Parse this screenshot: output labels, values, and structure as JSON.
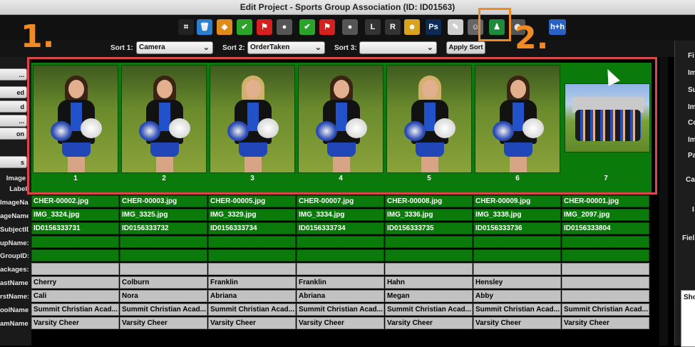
{
  "window": {
    "title": "Edit Project - Sports Group Association (ID: ID01563)"
  },
  "toolbar": {
    "icons": [
      {
        "name": "crop-icon",
        "glyph": "⌗",
        "color": "#222"
      },
      {
        "name": "trash-icon",
        "glyph": "🗑",
        "color": "#2b7fd1"
      },
      {
        "name": "tag-icon",
        "glyph": "◆",
        "color": "#e08a1a"
      },
      {
        "name": "check-icon",
        "glyph": "✔",
        "color": "#2aa52a"
      },
      {
        "name": "flag-icon",
        "glyph": "⚑",
        "color": "#d52020"
      },
      {
        "name": "grey-person-icon",
        "glyph": "●",
        "color": "#555"
      },
      {
        "name": "check-alt-icon",
        "glyph": "✔",
        "color": "#2aa52a"
      },
      {
        "name": "flag-alt-icon",
        "glyph": "⚑",
        "color": "#d52020"
      },
      {
        "name": "grey-person-alt-icon",
        "glyph": "●",
        "color": "#555"
      },
      {
        "name": "clock-l-icon",
        "glyph": "L",
        "color": "#333"
      },
      {
        "name": "clock-r-icon",
        "glyph": "R",
        "color": "#333"
      },
      {
        "name": "people-icon",
        "glyph": "☻",
        "color": "#d9a31f"
      },
      {
        "name": "photoshop-icon",
        "glyph": "Ps",
        "color": "#0b2a55"
      },
      {
        "name": "note-icon",
        "glyph": "✎",
        "color": "#cfcfcf"
      },
      {
        "name": "person-card-icon",
        "glyph": "☺",
        "color": "#666"
      },
      {
        "name": "group-pose-icon",
        "glyph": "♟",
        "color": "#1e8a3a"
      },
      {
        "name": "camera-icon",
        "glyph": "◉",
        "color": "#555"
      },
      {
        "name": "hh-icon",
        "glyph": "h+h",
        "color": "#2a62c4"
      }
    ]
  },
  "annotations": {
    "step1": "1.",
    "step2": "2."
  },
  "sort": {
    "sort1_label": "Sort 1:",
    "sort1_value": "Camera",
    "sort2_label": "Sort 2:",
    "sort2_value": "OrderTaken",
    "sort3_label": "Sort 3:",
    "sort3_value": "",
    "apply_label": "Apply Sort"
  },
  "left_buttons": [
    "...",
    "ed",
    "d",
    "...",
    "on",
    "s"
  ],
  "gallery": {
    "label_image": "Image :",
    "label_label": "Label",
    "numbers": [
      "1",
      "2",
      "3",
      "4",
      "5",
      "6",
      "7"
    ]
  },
  "row_labels": [
    "ImageName:",
    "ageName:",
    "SubjectID:",
    "upName:",
    "GroupID:",
    "ackages:",
    "astName:",
    "rstName:",
    "oolName:",
    "amName:"
  ],
  "table": {
    "ImageName": [
      "CHER-00002.jpg",
      "CHER-00003.jpg",
      "CHER-00005.jpg",
      "CHER-00007.jpg",
      "CHER-00008.jpg",
      "CHER-00009.jpg",
      "CHER-00001.jpg"
    ],
    "StageName": [
      "IMG_3324.jpg",
      "IMG_3325.jpg",
      "IMG_3329.jpg",
      "IMG_3334.jpg",
      "IMG_3336.jpg",
      "IMG_3338.jpg",
      "IMG_2097.jpg"
    ],
    "SubjectID": [
      "ID0156333731",
      "ID0156333732",
      "ID0156333734",
      "ID0156333734",
      "ID0156333735",
      "ID0156333736",
      "ID0156333804"
    ],
    "GroupName": [
      "",
      "",
      "",
      "",
      "",
      "",
      ""
    ],
    "GroupID": [
      "",
      "",
      "",
      "",
      "",
      "",
      ""
    ],
    "Packages": [
      "",
      "",
      "",
      "",
      "",
      "",
      ""
    ],
    "LastName": [
      "Cherry",
      "Colburn",
      "Franklin",
      "Franklin",
      "Hahn",
      "Hensley",
      ""
    ],
    "FirstName": [
      "Cali",
      "Nora",
      "Abriana",
      "Abriana",
      "Megan",
      "Abby",
      ""
    ],
    "SchoolName": [
      "Summit Christian Acad...",
      "Summit Christian Acad...",
      "Summit Christian Acad...",
      "Summit Christian Acad...",
      "Summit Christian Acad...",
      "Summit Christian Acad...",
      "Summit Christian Acad..."
    ],
    "TeamName": [
      "Varsity Cheer",
      "Varsity Cheer",
      "Varsity Cheer",
      "Varsity Cheer",
      "Varsity Cheer",
      "Varsity Cheer",
      "Varsity Cheer"
    ]
  },
  "right_panel": {
    "labels": [
      "Fi",
      "Im",
      "Su",
      "Im",
      "Co",
      "Im",
      "Pa",
      "Ca",
      "I",
      "Fiel"
    ],
    "box_label": "Sho"
  },
  "colors": {
    "accent_red": "#d94848",
    "accent_orange": "#f08a24",
    "grid_green": "#0a7a0a"
  }
}
